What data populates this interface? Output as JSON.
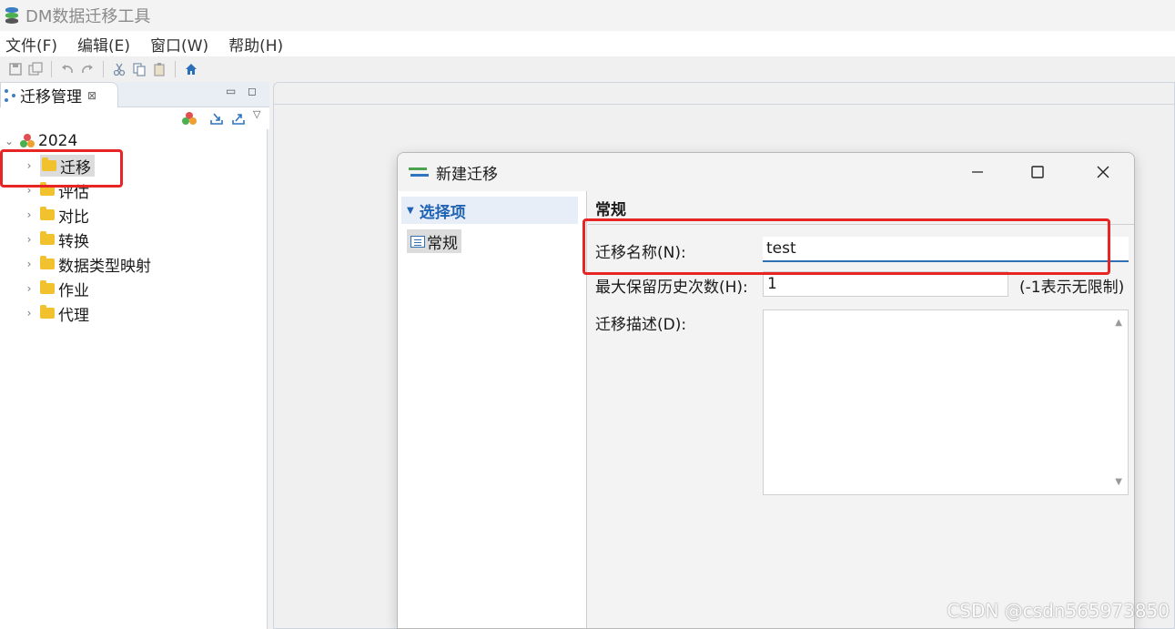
{
  "window": {
    "title": "DM数据迁移工具"
  },
  "menu": [
    "文件(F)",
    "编辑(E)",
    "窗口(W)",
    "帮助(H)"
  ],
  "toolbar": {
    "icons": [
      "save-icon",
      "save-all-icon",
      "undo-icon",
      "redo-icon",
      "cut-icon",
      "copy-icon",
      "paste-icon",
      "home-icon"
    ]
  },
  "view": {
    "tab_label": "迁移管理",
    "tree": {
      "root": "2024",
      "children": [
        "迁移",
        "评估",
        "对比",
        "转换",
        "数据类型映射",
        "作业",
        "代理"
      ]
    }
  },
  "dialog": {
    "title": "新建迁移",
    "nav_header": "选择项",
    "nav_item": "常规",
    "section_title": "常规",
    "fields": {
      "name_label": "迁移名称(N):",
      "name_value": "test",
      "history_label": "最大保留历史次数(H):",
      "history_value": "1",
      "history_hint": "(-1表示无限制)",
      "desc_label": "迁移描述(D):"
    }
  },
  "watermark": "CSDN @csdn565973850",
  "colors": {
    "annotation_red": "#e82525",
    "accent_blue": "#1f63b4",
    "folder_yellow": "#f2c12e"
  }
}
